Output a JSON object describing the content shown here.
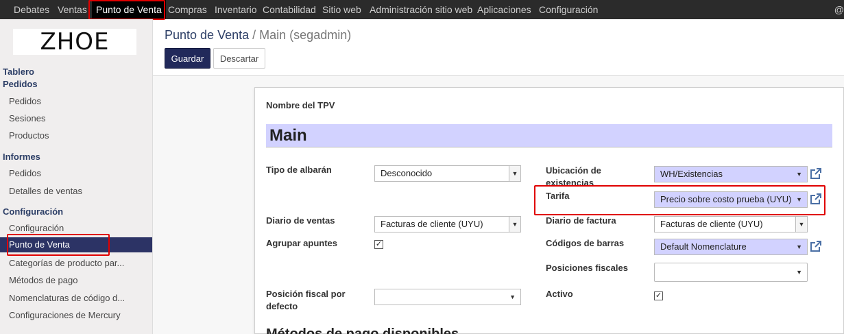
{
  "topnav": {
    "items": [
      "Debates",
      "Ventas",
      "Punto de Venta",
      "Compras",
      "Inventario",
      "Contabilidad",
      "Sitio web",
      "Administración sitio web",
      "Aplicaciones",
      "Configuración"
    ],
    "active": "Punto de Venta",
    "trailing": "@"
  },
  "sidebar": {
    "logo": "ZHOE",
    "tablero": "Tablero",
    "pedidos_head": "Pedidos",
    "pedidos": [
      "Pedidos",
      "Sesiones",
      "Productos"
    ],
    "informes_head": "Informes",
    "informes": [
      "Pedidos",
      "Detalles de ventas"
    ],
    "config_head": "Configuración",
    "config": [
      "Configuración",
      "Punto de Venta",
      "Categorías de producto par...",
      "Métodos de pago",
      "Nomenclaturas de código d...",
      "Configuraciones de Mercury"
    ]
  },
  "breadcrumb": {
    "parent": "Punto de Venta",
    "sep": "/",
    "current": "Main (segadmin)"
  },
  "buttons": {
    "save": "Guardar",
    "discard": "Descartar"
  },
  "form": {
    "name_label": "Nombre del TPV",
    "name_value": "Main",
    "tipo_albaran_label": "Tipo de albarán",
    "tipo_albaran_value": "Desconocido",
    "diario_ventas_label": "Diario de ventas",
    "diario_ventas_value": "Facturas de cliente (UYU)",
    "agrupar_label": "Agrupar apuntes",
    "agrupar_checked": "✓",
    "posicion_fiscal_label": "Posición fiscal por defecto",
    "posicion_fiscal_value": "",
    "ubicacion_label": "Ubicación de existencias",
    "ubicacion_value": "WH/Existencias",
    "tarifa_label": "Tarifa",
    "tarifa_value": "Precio sobre costo prueba (UYU)",
    "diario_factura_label": "Diario de factura",
    "diario_factura_value": "Facturas de cliente (UYU)",
    "codigos_label": "Códigos de barras",
    "codigos_value": "Default Nomenclature",
    "posiciones_label": "Posiciones fiscales",
    "posiciones_value": "",
    "activo_label": "Activo",
    "activo_checked": "✓",
    "section_title": "Métodos de pago disponibles"
  }
}
